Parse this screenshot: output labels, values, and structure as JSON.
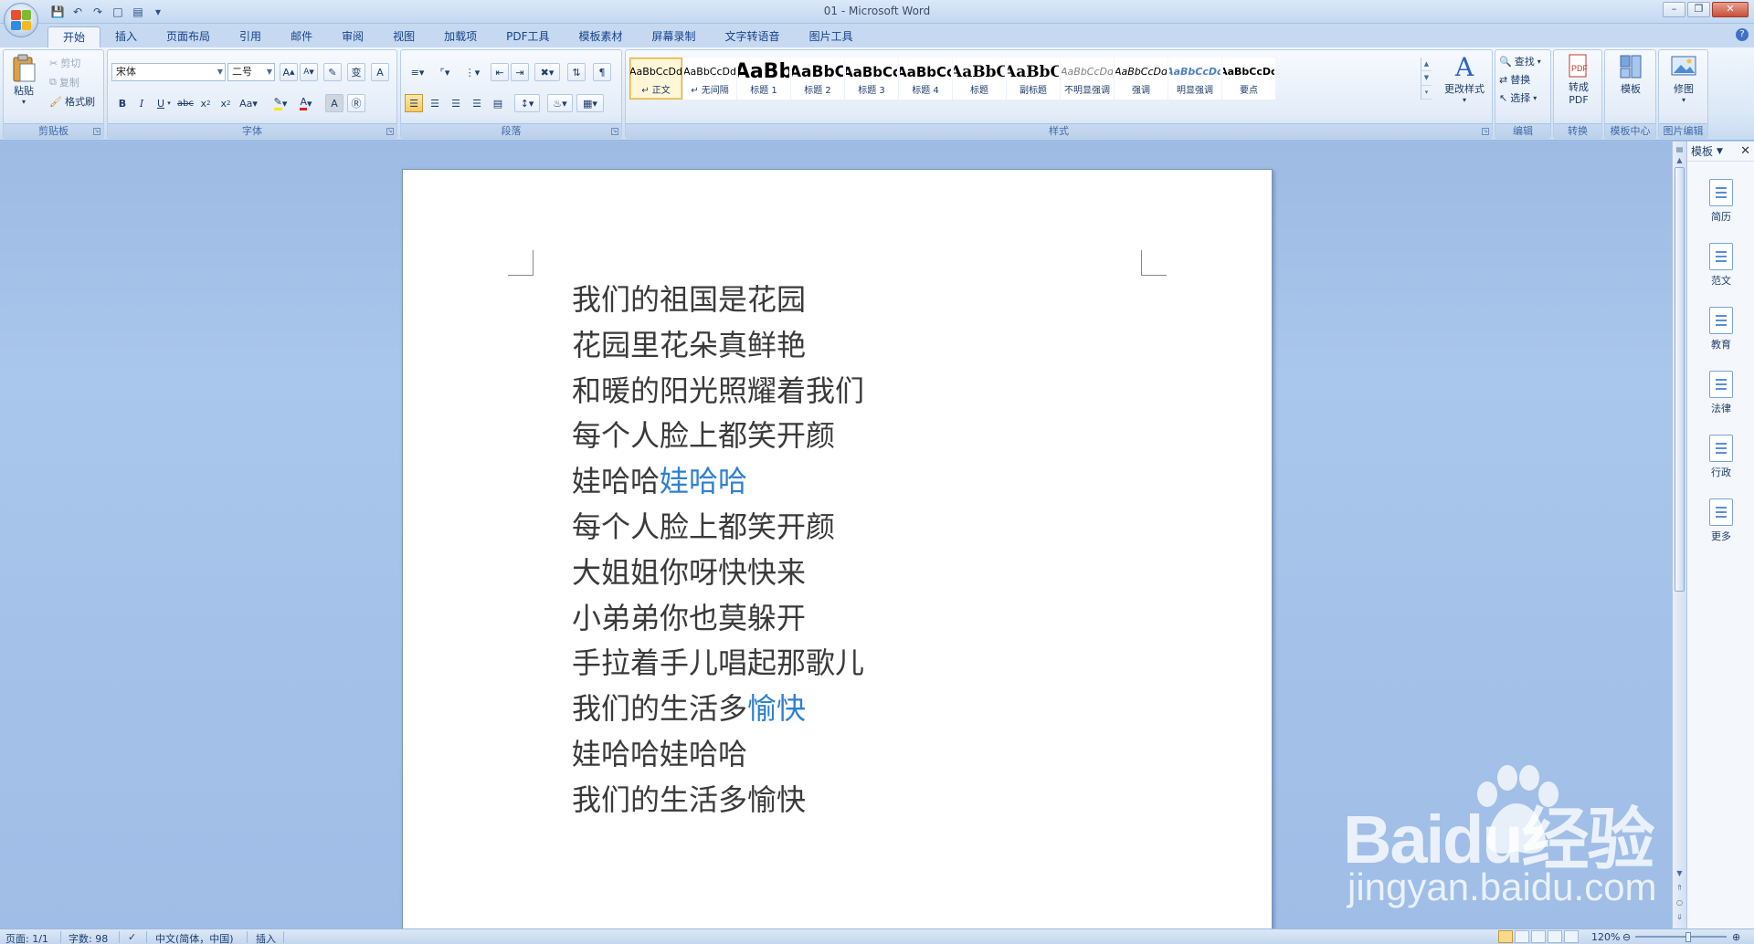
{
  "window": {
    "title": "01 - Microsoft Word"
  },
  "tabs": [
    "开始",
    "插入",
    "页面布局",
    "引用",
    "邮件",
    "审阅",
    "视图",
    "加载项",
    "PDF工具",
    "模板素材",
    "屏幕录制",
    "文字转语音",
    "图片工具"
  ],
  "ribbon": {
    "clipboard": {
      "label": "剪贴板",
      "paste": "粘贴",
      "cut": "剪切",
      "copy": "复制",
      "format_painter": "格式刷"
    },
    "font": {
      "label": "字体",
      "font_name": "宋体",
      "font_size": "二号"
    },
    "paragraph": {
      "label": "段落"
    },
    "styles": {
      "label": "样式",
      "items": [
        {
          "sample": "AaBbCcDd",
          "name": "↵ 正文"
        },
        {
          "sample": "AaBbCcDd",
          "name": "↵ 无间隔"
        },
        {
          "sample": "AaBb",
          "name": "标题 1"
        },
        {
          "sample": "AaBbC",
          "name": "标题 2"
        },
        {
          "sample": "AaBbCc",
          "name": "标题 3"
        },
        {
          "sample": "AaBbCc",
          "name": "标题 4"
        },
        {
          "sample": "AaBbC",
          "name": "标题"
        },
        {
          "sample": "AaBbC",
          "name": "副标题"
        },
        {
          "sample": "AaBbCcDd",
          "name": "不明显强调"
        },
        {
          "sample": "AaBbCcDd",
          "name": "强调"
        },
        {
          "sample": "AaBbCcDd",
          "name": "明显强调"
        },
        {
          "sample": "AaBbCcDd",
          "name": "要点"
        }
      ],
      "change_styles": "更改样式"
    },
    "editing": {
      "label": "编辑",
      "find": "查找",
      "replace": "替换",
      "select": "选择"
    },
    "convert": {
      "label": "转换",
      "to_pdf": "转成PDF"
    },
    "template_center": {
      "label": "模板中心",
      "button": "模板"
    },
    "image_edit": {
      "label": "图片编辑",
      "button": "修图"
    }
  },
  "document": {
    "lines": [
      {
        "text": "我们的祖国是花园",
        "blue": ""
      },
      {
        "text": "花园里花朵真鲜艳",
        "blue": ""
      },
      {
        "text": "和暖的阳光照耀着我们",
        "blue": ""
      },
      {
        "text": "每个人脸上都笑开颜",
        "blue": ""
      },
      {
        "text": "娃哈哈",
        "blue": "娃哈哈"
      },
      {
        "text": "每个人脸上都笑开颜",
        "blue": ""
      },
      {
        "text": "大姐姐你呀快快来",
        "blue": ""
      },
      {
        "text": "小弟弟你也莫躲开",
        "blue": ""
      },
      {
        "text": "手拉着手儿唱起那歌儿",
        "blue": ""
      },
      {
        "text": "我们的生活多",
        "blue": "愉快"
      },
      {
        "text": "娃哈哈娃哈哈",
        "blue": ""
      },
      {
        "text": "我们的生活多愉快",
        "blue": ""
      }
    ],
    "accent_color": "#2f80d1"
  },
  "side_panel": {
    "title": "模板",
    "items": [
      "简历",
      "范文",
      "教育",
      "法律",
      "行政",
      "更多"
    ]
  },
  "status": {
    "page": "页面: 1/1",
    "words": "字数: 98",
    "language": "中文(简体，中国)",
    "mode": "插入",
    "zoom": "120%"
  },
  "watermark": {
    "logo": "Baidu经验",
    "url": "jingyan.baidu.com"
  }
}
